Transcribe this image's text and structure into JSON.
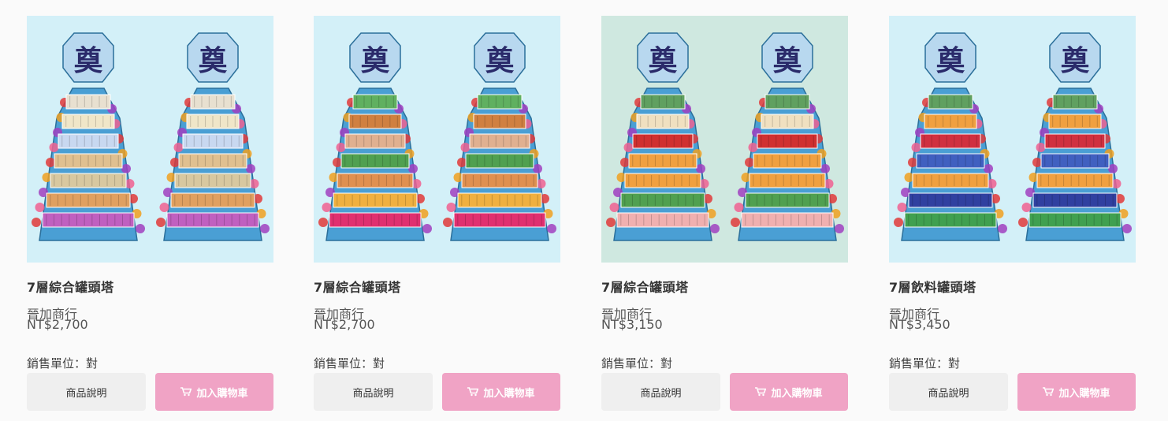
{
  "products": [
    {
      "title": "7層綜合罐頭塔",
      "seller": "晉加商行",
      "price": "NT$2,700",
      "unit": "銷售單位：對",
      "desc_label": "商品說明",
      "cart_label": "加入購物車",
      "bg_color": "#d3f0f8",
      "tower_char": "奠",
      "shelf_colors": [
        "#e8e0d0",
        "#f0e6c8",
        "#c8d8f0",
        "#e0c090",
        "#d8c8a0",
        "#e0a060",
        "#c060c0"
      ]
    },
    {
      "title": "7層綜合罐頭塔",
      "seller": "晉加商行",
      "price": "NT$2,700",
      "unit": "銷售單位：對",
      "desc_label": "商品說明",
      "cart_label": "加入購物車",
      "bg_color": "#d3f0f8",
      "tower_char": "奠",
      "shelf_colors": [
        "#60b060",
        "#d08040",
        "#e0b090",
        "#50a050",
        "#e09050",
        "#f0b040",
        "#e03070"
      ]
    },
    {
      "title": "7層綜合罐頭塔",
      "seller": "晉加商行",
      "price": "NT$3,150",
      "unit": "銷售單位：對",
      "desc_label": "商品說明",
      "cart_label": "加入購物車",
      "bg_color": "#cfe8e0",
      "tower_char": "奠",
      "shelf_colors": [
        "#60a060",
        "#f0e0c0",
        "#d03030",
        "#f0a040",
        "#f0a040",
        "#50a050",
        "#f0b0b0"
      ]
    },
    {
      "title": "7層飲料罐頭塔",
      "seller": "晉加商行",
      "price": "NT$3,450",
      "unit": "銷售單位：對",
      "desc_label": "商品說明",
      "cart_label": "加入購物車",
      "bg_color": "#d3f0f8",
      "tower_char": "奠",
      "shelf_colors": [
        "#60a060",
        "#f0a040",
        "#d03040",
        "#4060c0",
        "#f0a040",
        "#3040a0",
        "#40a050"
      ]
    }
  ],
  "colors": {
    "tower_blue": "#4a9fd4",
    "cart_button": "#f0a3c5",
    "desc_button": "#efefef",
    "accent_dark": "#2a2a6a"
  }
}
